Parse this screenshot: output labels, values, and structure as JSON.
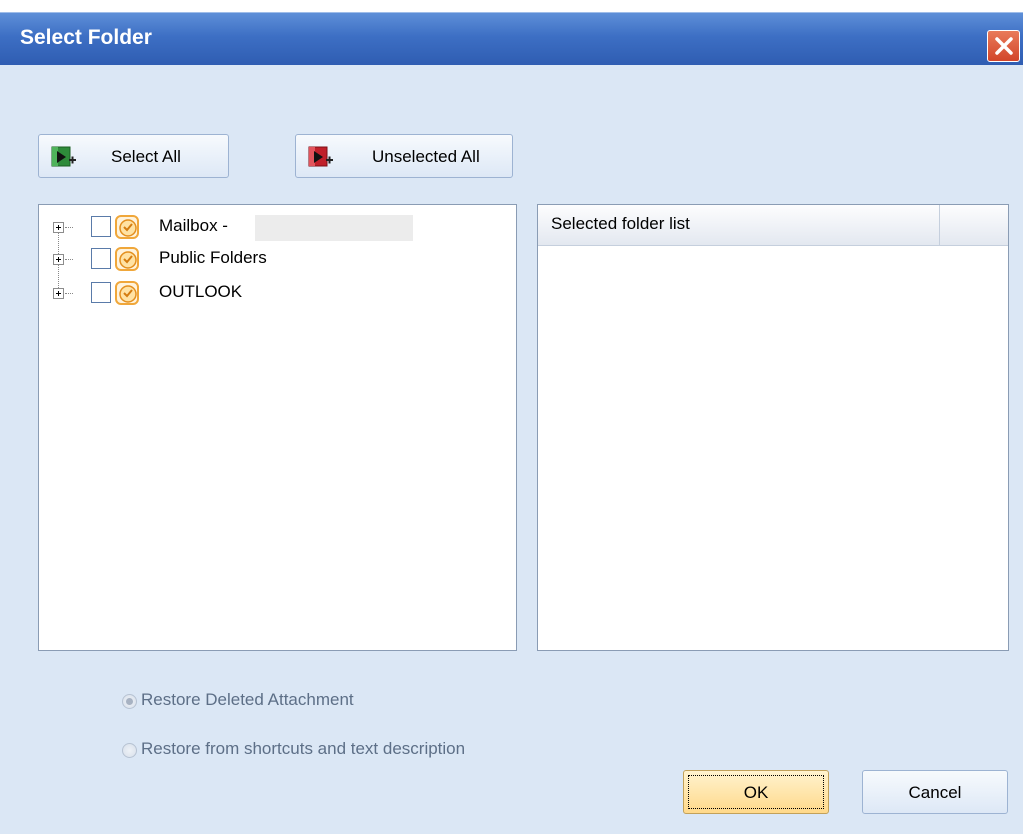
{
  "window": {
    "title": "Select Folder"
  },
  "toolbar": {
    "select_all_label": "Select All",
    "unselected_all_label": "Unselected All"
  },
  "tree": {
    "items": [
      {
        "label": "Mailbox -",
        "checked": false
      },
      {
        "label": "Public Folders",
        "checked": false
      },
      {
        "label": "OUTLOOK",
        "checked": false
      }
    ]
  },
  "selected_list": {
    "column_header": "Selected folder list"
  },
  "options": {
    "restore_deleted_attachment": "Restore Deleted Attachment",
    "restore_from_shortcuts": "Restore from shortcuts and text description",
    "selected": "restore_deleted_attachment"
  },
  "footer": {
    "ok_label": "OK",
    "cancel_label": "Cancel"
  }
}
